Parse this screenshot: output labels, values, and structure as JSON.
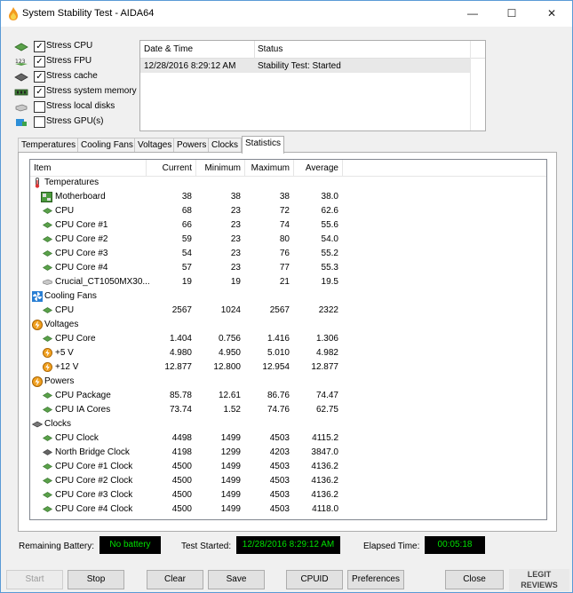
{
  "window": {
    "title": "System Stability Test - AIDA64"
  },
  "stress_options": [
    {
      "label": "Stress CPU",
      "checked": true,
      "icon": "cpu-chip-icon"
    },
    {
      "label": "Stress FPU",
      "checked": true,
      "icon": "fpu-123-icon"
    },
    {
      "label": "Stress cache",
      "checked": true,
      "icon": "cache-chip-icon"
    },
    {
      "label": "Stress system memory",
      "checked": true,
      "icon": "memory-module-icon"
    },
    {
      "label": "Stress local disks",
      "checked": false,
      "icon": "disk-icon"
    },
    {
      "label": "Stress GPU(s)",
      "checked": false,
      "icon": "gpu-icon"
    }
  ],
  "status_table": {
    "headers": {
      "date": "Date & Time",
      "status": "Status"
    },
    "rows": [
      {
        "date": "12/28/2016 8:29:12 AM",
        "status": "Stability Test: Started"
      }
    ]
  },
  "tabs": [
    "Temperatures",
    "Cooling Fans",
    "Voltages",
    "Powers",
    "Clocks",
    "Statistics"
  ],
  "active_tab": "Statistics",
  "stats": {
    "headers": {
      "item": "Item",
      "current": "Current",
      "minimum": "Minimum",
      "maximum": "Maximum",
      "average": "Average"
    },
    "groups": {
      "temperatures": "Temperatures",
      "cooling_fans": "Cooling Fans",
      "voltages": "Voltages",
      "powers": "Powers",
      "clocks": "Clocks"
    },
    "rows": [
      {
        "name": "Motherboard",
        "current": "38",
        "min": "38",
        "max": "38",
        "avg": "38.0"
      },
      {
        "name": "CPU",
        "current": "68",
        "min": "23",
        "max": "72",
        "avg": "62.6"
      },
      {
        "name": "CPU Core #1",
        "current": "66",
        "min": "23",
        "max": "74",
        "avg": "55.6"
      },
      {
        "name": "CPU Core #2",
        "current": "59",
        "min": "23",
        "max": "80",
        "avg": "54.0"
      },
      {
        "name": "CPU Core #3",
        "current": "54",
        "min": "23",
        "max": "76",
        "avg": "55.2"
      },
      {
        "name": "CPU Core #4",
        "current": "57",
        "min": "23",
        "max": "77",
        "avg": "55.3"
      },
      {
        "name": "Crucial_CT1050MX30...",
        "current": "19",
        "min": "19",
        "max": "21",
        "avg": "19.5"
      },
      {
        "name": "CPU",
        "current": "2567",
        "min": "1024",
        "max": "2567",
        "avg": "2322"
      },
      {
        "name": "CPU Core",
        "current": "1.404",
        "min": "0.756",
        "max": "1.416",
        "avg": "1.306"
      },
      {
        "name": "+5 V",
        "current": "4.980",
        "min": "4.950",
        "max": "5.010",
        "avg": "4.982"
      },
      {
        "name": "+12 V",
        "current": "12.877",
        "min": "12.800",
        "max": "12.954",
        "avg": "12.877"
      },
      {
        "name": "CPU Package",
        "current": "85.78",
        "min": "12.61",
        "max": "86.76",
        "avg": "74.47"
      },
      {
        "name": "CPU IA Cores",
        "current": "73.74",
        "min": "1.52",
        "max": "74.76",
        "avg": "62.75"
      },
      {
        "name": "CPU Clock",
        "current": "4498",
        "min": "1499",
        "max": "4503",
        "avg": "4115.2"
      },
      {
        "name": "North Bridge Clock",
        "current": "4198",
        "min": "1299",
        "max": "4203",
        "avg": "3847.0"
      },
      {
        "name": "CPU Core #1 Clock",
        "current": "4500",
        "min": "1499",
        "max": "4503",
        "avg": "4136.2"
      },
      {
        "name": "CPU Core #2 Clock",
        "current": "4500",
        "min": "1499",
        "max": "4503",
        "avg": "4136.2"
      },
      {
        "name": "CPU Core #3 Clock",
        "current": "4500",
        "min": "1499",
        "max": "4503",
        "avg": "4136.2"
      },
      {
        "name": "CPU Core #4 Clock",
        "current": "4500",
        "min": "1499",
        "max": "4503",
        "avg": "4118.0"
      }
    ]
  },
  "info": {
    "battery_label": "Remaining Battery:",
    "battery_value": "No battery",
    "started_label": "Test Started:",
    "started_value": "12/28/2016 8:29:12 AM",
    "elapsed_label": "Elapsed Time:",
    "elapsed_value": "00:05:18"
  },
  "buttons": {
    "start": "Start",
    "stop": "Stop",
    "clear": "Clear",
    "save": "Save",
    "cpuid": "CPUID",
    "preferences": "Preferences",
    "close": "Close"
  },
  "watermark": "LEGIT REVIEWS",
  "colors": {
    "value_green": "#00e000",
    "value_bg": "#000000",
    "selected_row": "#e8e8e8"
  }
}
